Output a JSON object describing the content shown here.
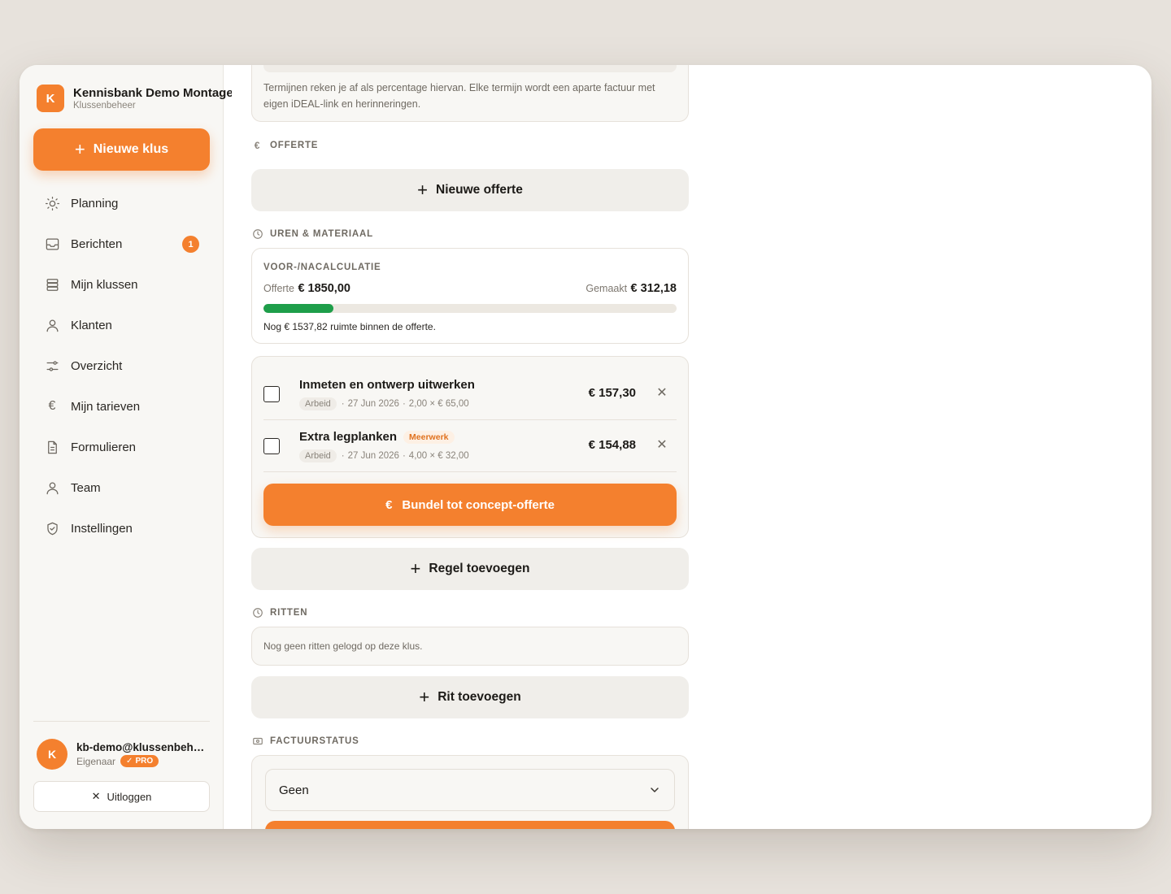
{
  "brand": {
    "logo_letter": "K",
    "name": "Kennisbank Demo Montage",
    "subtitle": "Klussenbeheer"
  },
  "sidebar": {
    "new_job_label": "Nieuwe klus",
    "items": [
      {
        "label": "Planning",
        "icon": "sun-icon"
      },
      {
        "label": "Berichten",
        "icon": "inbox-icon",
        "badge": "1"
      },
      {
        "label": "Mijn klussen",
        "icon": "stack-icon"
      },
      {
        "label": "Klanten",
        "icon": "user-icon"
      },
      {
        "label": "Overzicht",
        "icon": "sliders-icon"
      },
      {
        "label": "Mijn tarieven",
        "icon": "euro-icon"
      },
      {
        "label": "Formulieren",
        "icon": "document-icon"
      },
      {
        "label": "Team",
        "icon": "user-icon"
      },
      {
        "label": "Instellingen",
        "icon": "shield-icon"
      }
    ]
  },
  "user": {
    "avatar_letter": "K",
    "email": "kb-demo@klussenbeheer.nl",
    "role": "Eigenaar",
    "plan_badge": "PRO",
    "logout_label": "Uitloggen"
  },
  "main": {
    "intro_text": "Termijnen reken je af als percentage hiervan. Elke termijn wordt een aparte factuur met eigen iDEAL-link en herinneringen.",
    "quote_section": {
      "label": "OFFERTE",
      "new_quote_label": "Nieuwe offerte"
    },
    "hours_section": {
      "label": "UREN & MATERIAAL",
      "calc": {
        "title": "VOOR-/NACALCULATIE",
        "quote_label": "Offerte",
        "quote_value": "€ 1850,00",
        "made_label": "Gemaakt",
        "made_value": "€ 312,18",
        "progress_fraction": 0.169,
        "note": "Nog € 1537,82 ruimte binnen de offerte."
      },
      "lines": [
        {
          "title": "Inmeten en ontwerp uitwerken",
          "tag": "",
          "type": "Arbeid",
          "date": "27 Jun 2026",
          "calc": "2,00 × € 65,00",
          "price": "€ 157,30"
        },
        {
          "title": "Extra legplanken",
          "tag": "Meerwerk",
          "type": "Arbeid",
          "date": "27 Jun 2026",
          "calc": "4,00 × € 32,00",
          "price": "€ 154,88"
        }
      ],
      "bundle_label": "Bundel tot concept-offerte",
      "add_line_label": "Regel toevoegen"
    },
    "rides_section": {
      "label": "RITTEN",
      "empty_text": "Nog geen ritten gelogd op deze klus.",
      "add_ride_label": "Rit toevoegen"
    },
    "invoice_section": {
      "label": "FACTUURSTATUS",
      "status_value": "Geen"
    }
  },
  "colors": {
    "accent": "#f4802e",
    "progress": "#1e9e4a",
    "sidebar_bg": "#f8f7f4"
  }
}
